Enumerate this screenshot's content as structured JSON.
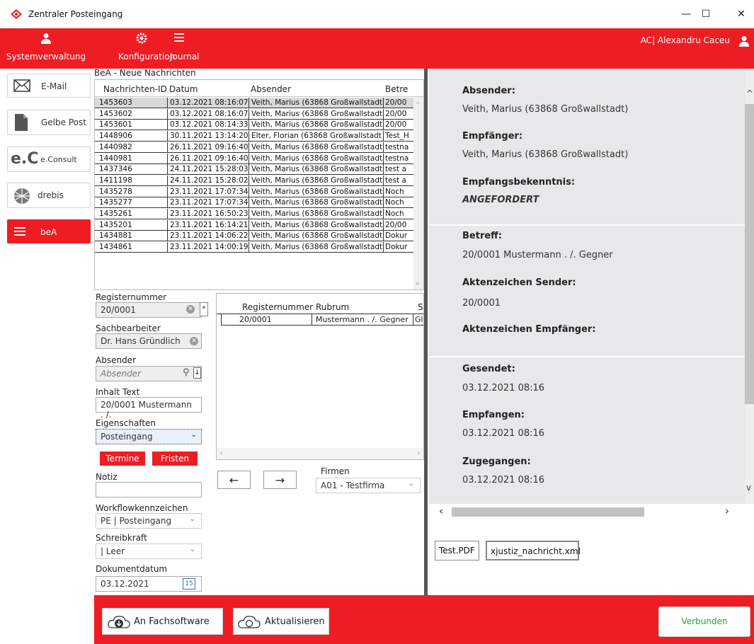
{
  "window": {
    "title": "Zentraler Posteingang",
    "minimize": "—",
    "maximize": "☐",
    "close": "✕"
  },
  "toolbar": {
    "items": [
      {
        "label": "Systemverwaltung",
        "icon": "user-icon"
      },
      {
        "label": "Konfiguration",
        "icon": "gear-icon"
      },
      {
        "label": "Journal",
        "icon": "list-icon"
      }
    ],
    "user": "AC| Alexandru Caceu"
  },
  "nav": [
    {
      "label": "E-Mail",
      "icon": "envelope-icon"
    },
    {
      "label": "Gelbe Post",
      "icon": "document-icon"
    },
    {
      "label": "e.Consult",
      "icon": "e-consult-logo"
    },
    {
      "label": "drebis",
      "icon": "drebis-logo"
    },
    {
      "label": "beA",
      "icon": "menu-icon",
      "active": true
    }
  ],
  "messages": {
    "title": "BeA - Neue Nachrichten",
    "columns": [
      "Nachrichten-ID",
      "Datum",
      "Absender",
      "Betre"
    ],
    "rows": [
      [
        "1453603",
        "03.12.2021 08:16:07",
        "Veith, Marius (63868 Großwallstadt)",
        "20/00"
      ],
      [
        "1453602",
        "03.12.2021 08:16:07",
        "Veith, Marius (63868 Großwallstadt)",
        "20/00"
      ],
      [
        "1453601",
        "03.12.2021 08:14:33",
        "Veith, Marius (63868 Großwallstadt)",
        "20/00"
      ],
      [
        "1448906",
        "30.11.2021 13:14:20",
        "Elter, Florian (63868 Großwallstadt)",
        "Test_H"
      ],
      [
        "1440982",
        "26.11.2021 09:16:40",
        "Veith, Marius (63868 Großwallstadt)",
        "testna"
      ],
      [
        "1440981",
        "26.11.2021 09:16:40",
        "Veith, Marius (63868 Großwallstadt)",
        "testna"
      ],
      [
        "1437346",
        "24.11.2021 15:28:03",
        "Veith, Marius (63868 Großwallstadt)",
        "test a"
      ],
      [
        "1411198",
        "24.11.2021 15:28:02",
        "Veith, Marius (63868 Großwallstadt)",
        "test a"
      ],
      [
        "1435278",
        "23.11.2021 17:07:34",
        "Veith, Marius (63868 Großwallstadt)",
        "Noch"
      ],
      [
        "1435277",
        "23.11.2021 17:07:34",
        "Veith, Marius (63868 Großwallstadt)",
        "Noch"
      ],
      [
        "1435261",
        "23.11.2021 16:50:23",
        "Veith, Marius (63868 Großwallstadt)",
        "Noch"
      ],
      [
        "1435201",
        "23.11.2021 16:14:21",
        "Veith, Marius (63868 Großwallstadt)",
        "20/00"
      ],
      [
        "1434881",
        "23.11.2021 14:06:22",
        "Veith, Marius (63868 Großwallstadt)",
        "Dokur"
      ],
      [
        "1434861",
        "23.11.2021 14:00:19",
        "Veith, Marius (63868 Großwallstadt)",
        "Dokur"
      ]
    ]
  },
  "form": {
    "registernummer_label": "Registernummer",
    "registernummer_value": "20/0001",
    "registernummer_star": "*",
    "sachbearbeiter_label": "Sachbearbeiter",
    "sachbearbeiter_value": "Dr. Hans Gründlich",
    "absender_label": "Absender",
    "absender_placeholder": "Absender",
    "inhalt_label": "Inhalt Text",
    "inhalt_value": "20/0001 Mustermann . /.",
    "eigenschaften_label": "Eigenschaften",
    "eigenschaften_value": "Posteingang",
    "termine": "Termine",
    "fristen": "Fristen",
    "notiz_label": "Notiz",
    "notiz_value": "",
    "workflow_label": "Workflowkennzeichen",
    "workflow_value": "PE  | Posteingang",
    "schreibkraft_label": "Schreibkraft",
    "schreibkraft_value": "| Leer",
    "dokumentdatum_label": "Dokumentdatum",
    "dokumentdatum_value": "03.12.2021",
    "calendar_day": "15"
  },
  "subtable": {
    "columns": [
      "Registernummer",
      "Rubrum",
      "S"
    ],
    "rows": [
      [
        "20/0001",
        "Mustermann . /. Gegner",
        "Gl"
      ]
    ]
  },
  "firmen": {
    "label": "Firmen",
    "value": "A01 - Testfirma"
  },
  "detail": {
    "absender_label": "Absender:",
    "absender_value": "Veith, Marius (63868 Großwallstadt)",
    "empfaenger_label": "Empfänger:",
    "empfaenger_value": "Veith, Marius (63868 Großwallstadt)",
    "ebk_label": "Empfangsbekenntnis:",
    "ebk_value": "ANGEFORDERT",
    "betreff_label": "Betreff:",
    "betreff_value": "20/0001 Mustermann . /. Gegner",
    "az_sender_label": "Aktenzeichen Sender:",
    "az_sender_value": "20/0001",
    "az_empf_label": "Aktenzeichen Empfänger:",
    "gesendet_label": "Gesendet:",
    "gesendet_value": "03.12.2021 08:16",
    "empfangen_label": "Empfangen:",
    "empfangen_value": "03.12.2021 08:16",
    "zugegangen_label": "Zugegangen:",
    "zugegangen_value": "03.12.2021 08:16"
  },
  "attachments": [
    "Test.PDF",
    "xjustiz_nachricht.xml"
  ],
  "bottom": {
    "fachsoftware": "An Fachsoftware",
    "aktualisieren": "Aktualisieren",
    "status": "Verbunden",
    "status_color": "#2e9e3b"
  },
  "colors": {
    "accent": "#ee1d23",
    "panel": "#e7e8e9"
  }
}
